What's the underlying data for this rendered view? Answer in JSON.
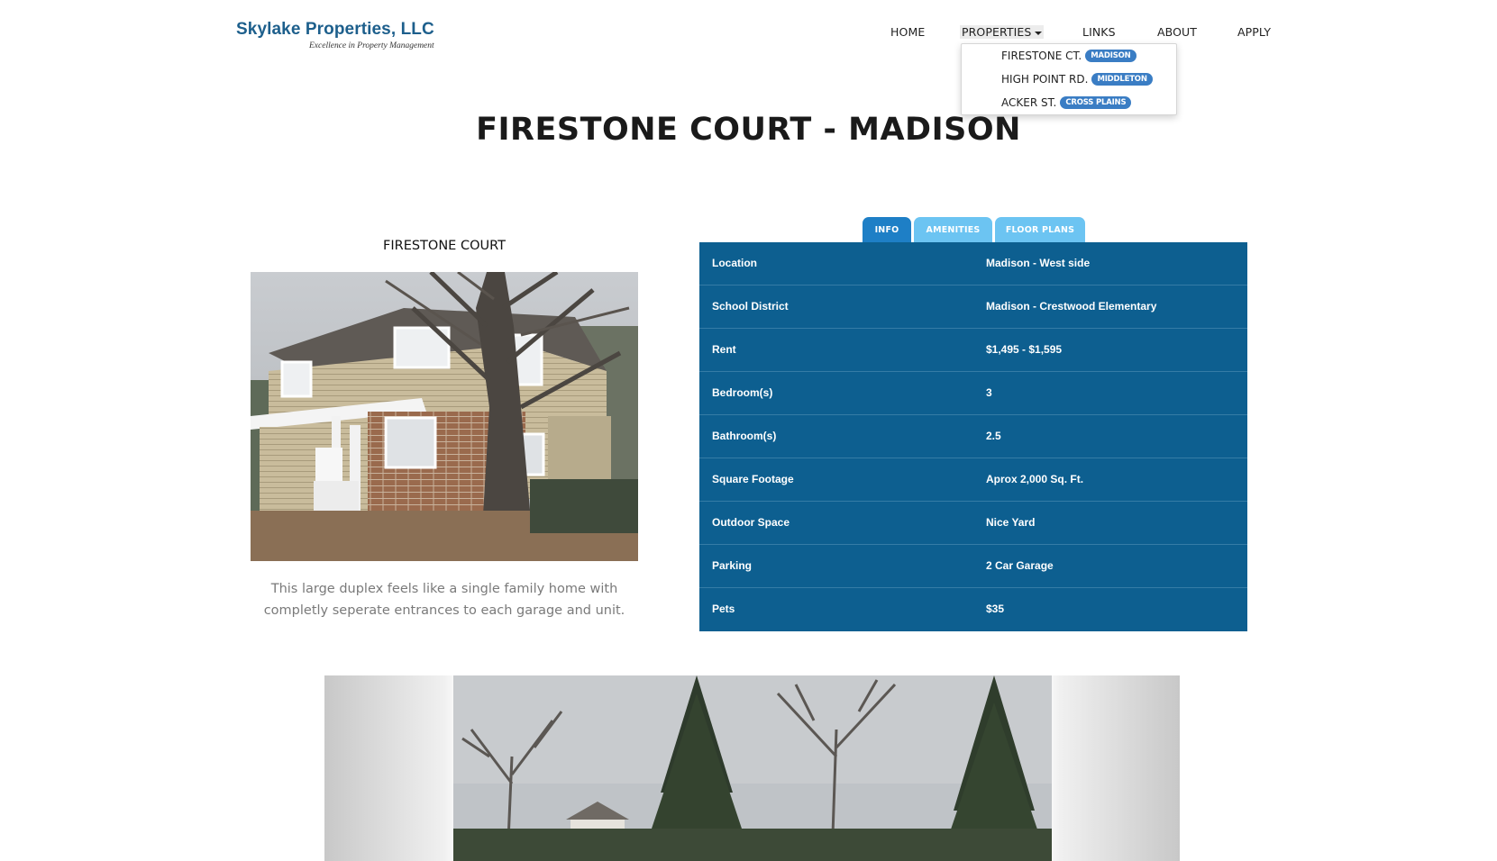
{
  "logo": {
    "name": "Skylake Properties, LLC",
    "tagline": "Excellence in Property Management"
  },
  "nav": {
    "home": "HOME",
    "properties": "PROPERTIES",
    "links": "LINKS",
    "about": "ABOUT",
    "apply": "APPLY"
  },
  "dropdown": {
    "items": [
      {
        "label": "FIRESTONE CT.",
        "badge": "MADISON"
      },
      {
        "label": "HIGH POINT RD.",
        "badge": "MIDDLETON"
      },
      {
        "label": "ACKER ST.",
        "badge": "CROSS PLAINS"
      }
    ]
  },
  "page_title": "FIRESTONE COURT - MADISON",
  "property": {
    "subtitle": "FIRESTONE COURT",
    "description": "This large duplex feels like a single family home with completly seperate entrances to each garage and unit."
  },
  "tabs": [
    "INFO",
    "AMENITIES",
    "FLOOR PLANS"
  ],
  "info": [
    {
      "label": "Location",
      "value": "Madison - West side"
    },
    {
      "label": "School District",
      "value": "Madison - Crestwood Elementary"
    },
    {
      "label": "Rent",
      "value": "$1,495 - $1,595"
    },
    {
      "label": "Bedroom(s)",
      "value": "3"
    },
    {
      "label": "Bathroom(s)",
      "value": "2.5"
    },
    {
      "label": "Square Footage",
      "value": "Aprox 2,000 Sq. Ft."
    },
    {
      "label": "Outdoor Space",
      "value": "Nice Yard"
    },
    {
      "label": "Parking",
      "value": "2 Car Garage"
    },
    {
      "label": "Pets",
      "value": "$35"
    }
  ],
  "colors": {
    "brand": "#1d5f8c",
    "table_bg": "#0d5f90",
    "tab_active": "#1e7fc6",
    "tab_inactive": "#6cc4f2",
    "badge": "#3a7dc4"
  }
}
